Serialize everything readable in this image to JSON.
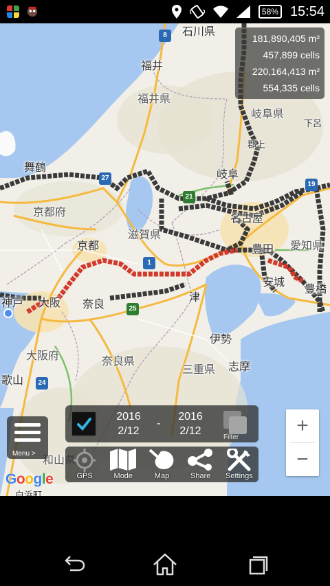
{
  "status_bar": {
    "battery": "58%",
    "time": "15:54",
    "icons": [
      "notification-app-icon",
      "notification-character-icon",
      "location-icon",
      "vibrate-icon",
      "wifi-icon",
      "signal-icon",
      "battery-icon"
    ]
  },
  "stats": {
    "area_total": "181,890,405 m²",
    "cells_total": "457,899 cells",
    "area_filtered": "220,164,413 m²",
    "cells_filtered": "554,335 cells"
  },
  "map_labels": {
    "ishikawa": "石川県",
    "fukui_city": "福井",
    "fukui_pref": "福井県",
    "gifu_pref": "岐阜県",
    "shimoro": "下呂",
    "gujo": "郡上",
    "maizuru": "舞鶴",
    "gifu": "岐阜",
    "kyoto_pref": "京都府",
    "shiga_pref": "滋賀県",
    "nagoya": "名古屋",
    "kyoto": "京都",
    "toyota": "豊田",
    "aichi_pref": "愛知県",
    "anjo": "安城",
    "toyohashi": "豊橋",
    "kobe": "神戸",
    "osaka": "大阪",
    "nara": "奈良",
    "tsu": "津",
    "ise": "伊勢",
    "osaka_pref": "大阪府",
    "nara_pref": "奈良県",
    "mie_pref": "三重県",
    "shima": "志摩",
    "kayama": "歌山",
    "wakayama_pref": "和山県",
    "shirahama": "白浜町"
  },
  "road_shields": {
    "r8": "8",
    "r27": "27",
    "r21": "21",
    "r19": "19",
    "r1": "1",
    "r25": "25",
    "r24": "24"
  },
  "zoom": {
    "in": "+",
    "out": "−"
  },
  "menu": {
    "label": "Menu >"
  },
  "date_filter": {
    "checked": true,
    "start_year": "2016",
    "start_date": "2/12",
    "separator": "-",
    "end_year": "2016",
    "end_date": "2/12",
    "filter_label": "Filter"
  },
  "toolbar": {
    "gps": "GPS",
    "mode": "Mode",
    "map": "Map",
    "share": "Share",
    "settings": "Settings"
  },
  "google_logo": [
    "G",
    "o",
    "o",
    "g",
    "l",
    "e"
  ],
  "colors": {
    "track_visited": "#3a3a3a",
    "track_new": "#d23a2c",
    "water": "#a6c8f0",
    "land": "#f1efe7",
    "highway": "#f5b93f",
    "checkbox_accent": "#33b5e5"
  }
}
